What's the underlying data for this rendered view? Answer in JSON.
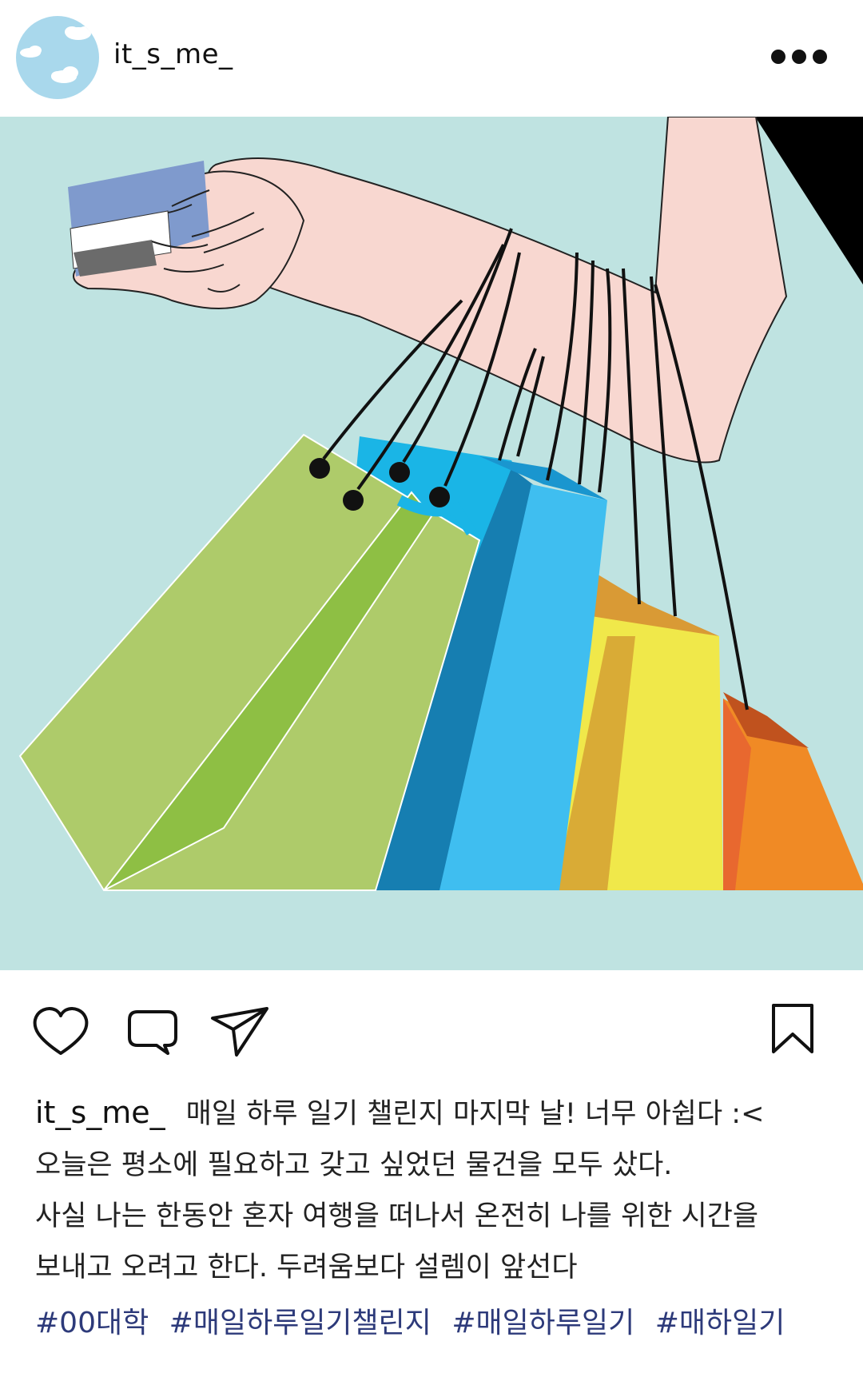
{
  "header": {
    "username": "it_s_me_",
    "avatar_icon": "cloud-sky-avatar",
    "more_icon": "more-horizontal-icon"
  },
  "post": {
    "image_description_icon": "shopping-bags-illustration"
  },
  "actions": {
    "like_icon": "heart-icon",
    "comment_icon": "comment-icon",
    "share_icon": "send-icon",
    "save_icon": "bookmark-icon"
  },
  "caption": {
    "username": "it_s_me_",
    "line1": "매일 하루 일기 챌린지 마지막 날! 너무 아쉽다 :<",
    "line2": "오늘은 평소에 필요하고 갖고 싶었던 물건을 모두 샀다.",
    "line3": "사실 나는 한동안 혼자 여행을 떠나서 온전히 나를 위한 시간을",
    "line4": "보내고 오려고 한다. 두려움보다 설렘이 앞선다"
  },
  "hashtags": [
    "#00대학",
    "#매일하루일기챌린지",
    "#매일하루일기",
    "#매하일기"
  ],
  "colors": {
    "background": "#bfe3e1",
    "hashtag": "#2d3a7a",
    "skin": "#f8d7d0",
    "bag_green": "#aecb6a",
    "bag_blue": "#1ab5e6",
    "bag_yellow": "#f0e84a",
    "bag_orange": "#f08a25"
  }
}
